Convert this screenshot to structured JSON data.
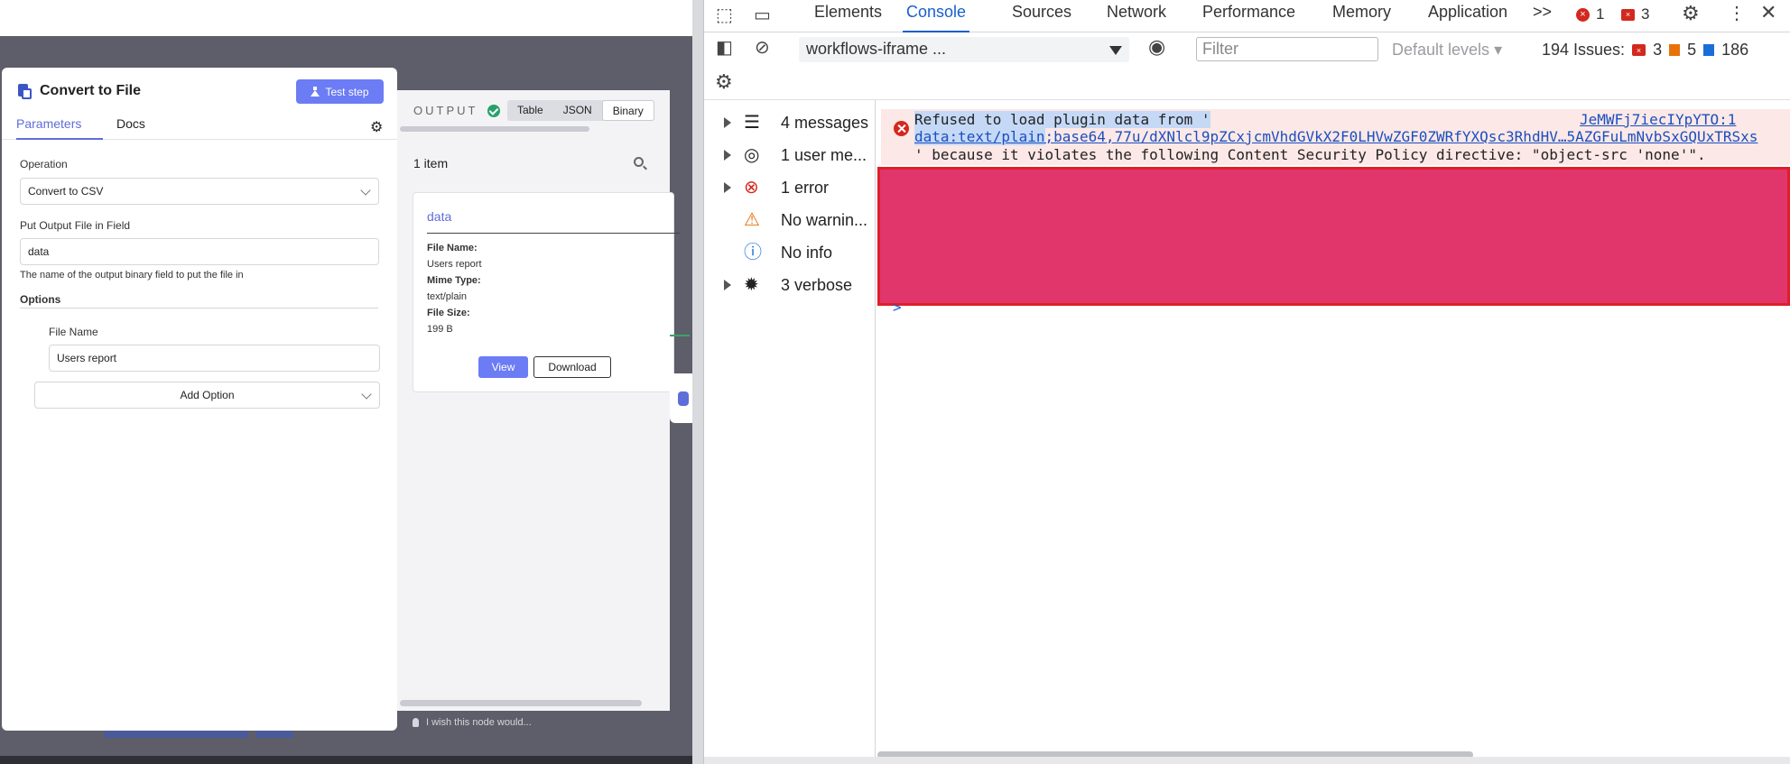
{
  "app": {
    "node_title": "Convert to File",
    "test_step_label": "Test step",
    "tabs": [
      "Parameters",
      "Docs"
    ],
    "operation_label": "Operation",
    "operation_value": "Convert to CSV",
    "output_field_label": "Put Output File in Field",
    "output_field_value": "data",
    "output_field_hint": "The name of the output binary field to put the file in",
    "options_heading": "Options",
    "file_name_label": "File Name",
    "file_name_value": "Users report",
    "add_option_label": "Add Option"
  },
  "output": {
    "label": "OUTPUT",
    "tabs": [
      "Table",
      "JSON",
      "Binary"
    ],
    "active_tab": "Binary",
    "items_count": "1 item",
    "card": {
      "title": "data",
      "file_name_key": "File Name:",
      "file_name_val": "Users report",
      "mime_key": "Mime Type:",
      "mime_val": "text/plain",
      "size_key": "File Size:",
      "size_val": "199 B",
      "view_label": "View",
      "download_label": "Download"
    },
    "feedback": "I wish this node would..."
  },
  "devtools": {
    "tabs": [
      "Elements",
      "Console",
      "Sources",
      "Network",
      "Performance",
      "Memory",
      "Application"
    ],
    "active_tab": "Console",
    "more_tabs": ">>",
    "error_count": "1",
    "issue_flag_count": "3",
    "context": "workflows-iframe ...",
    "filter_placeholder": "Filter",
    "levels_label": "Default levels",
    "issues_label": "194 Issues:",
    "issues_errors": "3",
    "issues_warnings": "5",
    "issues_info": "186",
    "sidebar": [
      {
        "label": "4 messages",
        "icon": "list-icon"
      },
      {
        "label": "1 user me...",
        "icon": "user-icon"
      },
      {
        "label": "1 error",
        "icon": "error-icon"
      },
      {
        "label": "No warnin...",
        "icon": "warning-icon"
      },
      {
        "label": "No info",
        "icon": "info-icon"
      },
      {
        "label": "3 verbose",
        "icon": "bug-icon"
      }
    ],
    "message": {
      "line1": "Refused to load plugin data from '",
      "source": "JeMWFj7iecIYpYTO:1",
      "line2_link_a": "data:text/plain",
      "line2_link_b": ";base64,77u/dXNlcl9pZCxjcmVhdGVkX2F0LHVwZGF0ZWRfYXQsc3RhdHV…5AZGFuLmNvbSxGQUxTRSxs",
      "line3": "' because it violates the following Content Security Policy directive: \"object-src 'none'\"."
    },
    "prompt_chevron": ">"
  },
  "colors": {
    "accent": "#6b7cf5",
    "devtools_active": "#1a5fcc",
    "error": "#d3281f",
    "redaction": "#e1366b"
  }
}
